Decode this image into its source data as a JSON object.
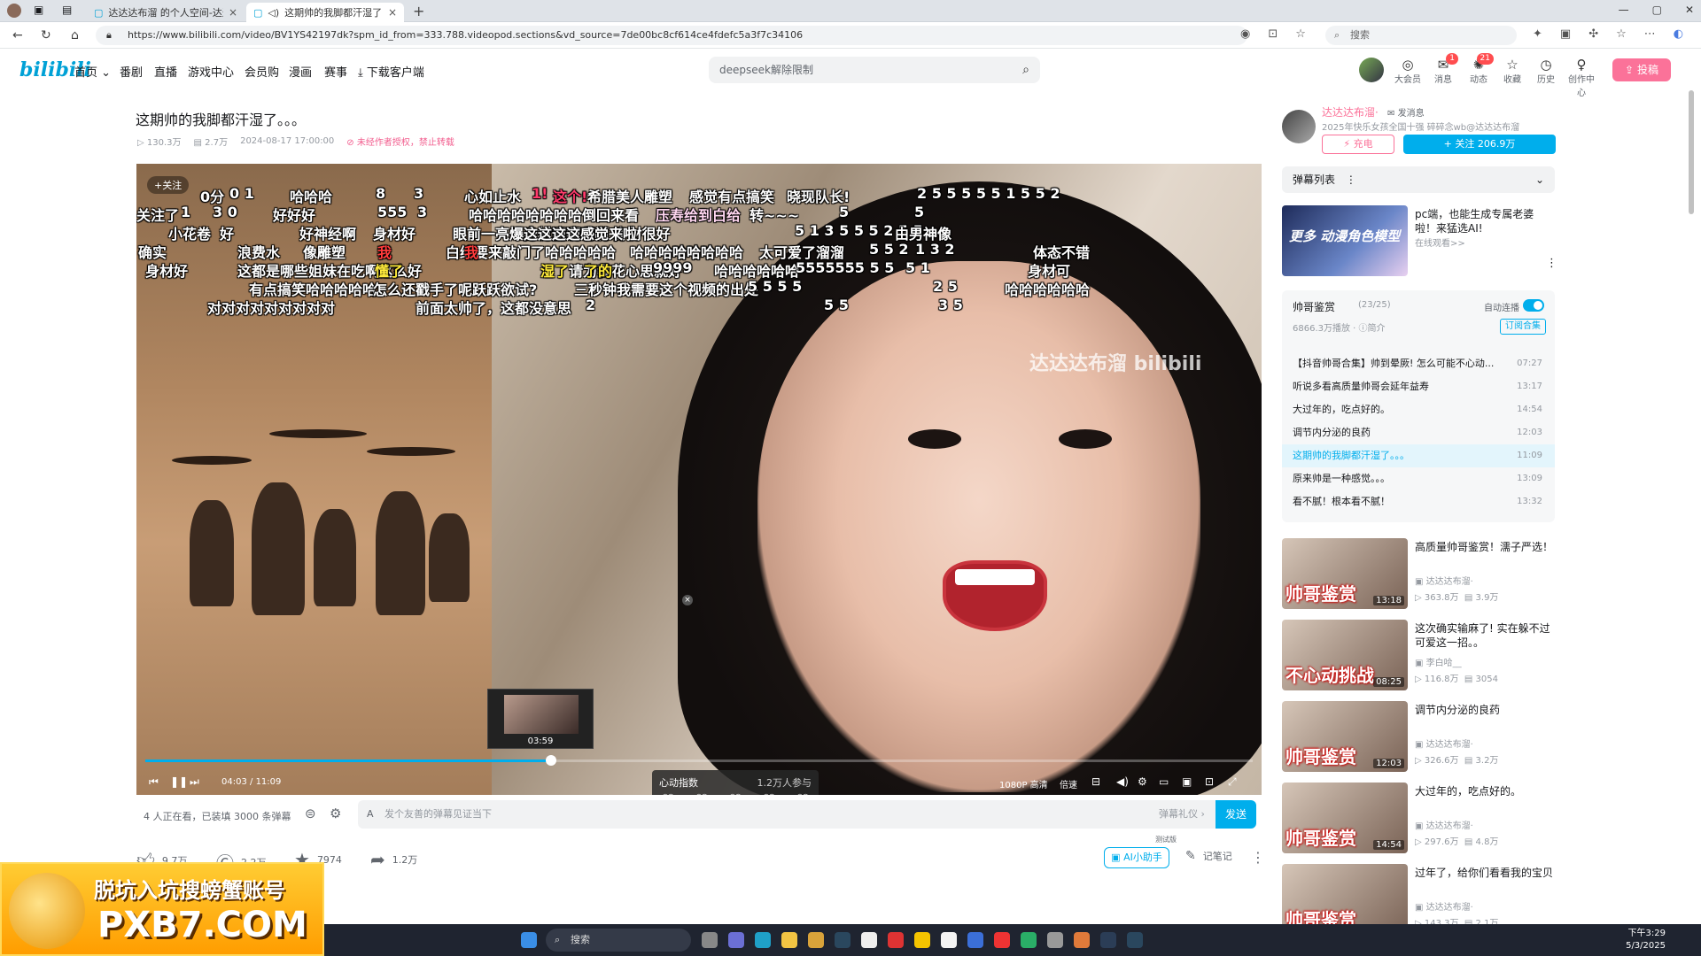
{
  "browser": {
    "tabs": [
      {
        "label": "达达达布溜 的个人空间-达达达布..."
      },
      {
        "label": "这期帅的我脚都汗湿了。。。"
      }
    ],
    "url": "https://www.bilibili.com/video/BV1YS42197dk?spm_id_from=333.788.videopod.sections&vd_source=7de00bc8cf614ce4fdefc5a3f7c34106",
    "search_placeholder": "搜索"
  },
  "site_header": {
    "logo": "bilibili",
    "nav": [
      "首页",
      "番剧",
      "直播",
      "游戏中心",
      "会员购",
      "漫画",
      "赛事",
      "下载客户端"
    ],
    "search_placeholder": "deepseek解除限制",
    "icons": [
      {
        "label": "大会员",
        "icon": "vip-icon"
      },
      {
        "label": "消息",
        "icon": "message-icon",
        "badge": "1"
      },
      {
        "label": "动态",
        "icon": "dynamic-icon",
        "badge": "21"
      },
      {
        "label": "收藏",
        "icon": "favorite-icon"
      },
      {
        "label": "历史",
        "icon": "history-icon"
      },
      {
        "label": "创作中心",
        "icon": "creator-icon"
      }
    ],
    "upload_label": "投稿"
  },
  "video": {
    "title": "这期帅的我脚都汗湿了。。。",
    "views": "130.3万",
    "danmaku_count": "2.7万",
    "date": "2024-08-17 17:00:00",
    "copyright": "未经作者授权，禁止转载"
  },
  "player": {
    "watermark": "达达达布溜 bilibili",
    "danmaku": [
      {
        "text": "0分",
        "c": "#fff"
      },
      {
        "text": "0 1",
        "c": "#fff"
      },
      {
        "text": "哈哈哈",
        "c": "#fff"
      },
      {
        "text": "8",
        "c": "#fff"
      },
      {
        "text": "3",
        "c": "#fff"
      },
      {
        "text": "心如止水",
        "c": "#fff"
      },
      {
        "text": "1!",
        "c": "#ff3b6b"
      },
      {
        "text": "这个!",
        "c": "#ff3b6b"
      },
      {
        "text": "希腊美人雕塑",
        "c": "#fff"
      },
      {
        "text": "感觉有点搞笑",
        "c": "#fff"
      },
      {
        "text": "晓现队长!",
        "c": "#fff"
      },
      {
        "text": "2 5 5 5 5 5 1 5 5 2",
        "c": "#fff"
      },
      {
        "text": "关注了",
        "c": "#fff"
      },
      {
        "text": "1",
        "c": "#fff"
      },
      {
        "text": "3 0",
        "c": "#fff"
      },
      {
        "text": "好好好",
        "c": "#fff"
      },
      {
        "text": "555",
        "c": "#fff"
      },
      {
        "text": "3",
        "c": "#fff"
      },
      {
        "text": "哈哈哈哈哈哈哈哈倒回来看",
        "c": "#fff"
      },
      {
        "text": "压寿给到白给",
        "c": "#ffd6f0"
      },
      {
        "text": "转~~~",
        "c": "#fff"
      },
      {
        "text": "5",
        "c": "#fff"
      },
      {
        "text": "5",
        "c": "#fff"
      },
      {
        "text": "小花卷",
        "c": "#fff"
      },
      {
        "text": "好",
        "c": "#fff"
      },
      {
        "text": "好神经啊",
        "c": "#fff"
      },
      {
        "text": "身材好",
        "c": "#fff"
      },
      {
        "text": "眼前一亮爆身材丽啊啊啊 身材很好",
        "c": "#fff"
      },
      {
        "text": "这这这这感觉来啦",
        "c": "#fff"
      },
      {
        "text": "5 1 3 5 5 5 2 5 5",
        "c": "#fff"
      },
      {
        "text": "由男神像",
        "c": "#fff"
      },
      {
        "text": "确实",
        "c": "#fff"
      },
      {
        "text": "浪费水",
        "c": "#fff"
      },
      {
        "text": "像雕塑",
        "c": "#fff"
      },
      {
        "text": "我",
        "c": "#ff3b3b"
      },
      {
        "text": "白给要来敲门了哈哈哈哈哈",
        "c": "#fff"
      },
      {
        "text": "我",
        "c": "#ff3b3b"
      },
      {
        "text": "哈哈哈哈哈哈",
        "c": "#fff"
      },
      {
        "text": "哈哈哈哈哈哈",
        "c": "#fff"
      },
      {
        "text": "太可爱了溜溜",
        "c": "#fff"
      },
      {
        "text": "5 5 2",
        "c": "#fff"
      },
      {
        "text": "1 3 2",
        "c": "#fff"
      },
      {
        "text": "体态不错",
        "c": "#fff"
      },
      {
        "text": "身材好",
        "c": "#fff"
      },
      {
        "text": "这都是哪些姐妹在吃啊这么好",
        "c": "#fff"
      },
      {
        "text": "懂了",
        "c": "#ffeb3b"
      },
      {
        "text": "湿了",
        "c": "#ffeb3b"
      },
      {
        "text": "请为我花心思就好",
        "c": "#fff"
      },
      {
        "text": "了的",
        "c": "#ffeb3b"
      },
      {
        "text": "9999",
        "c": "#fff"
      },
      {
        "text": "哈哈哈哈哈哈",
        "c": "#fff"
      },
      {
        "text": "5555555 5 5",
        "c": "#fff"
      },
      {
        "text": "5 1",
        "c": "#fff"
      },
      {
        "text": "身材可",
        "c": "#fff"
      },
      {
        "text": "有点搞笑哈哈哈哈哈",
        "c": "#fff"
      },
      {
        "text": "怎么还戳手了呢跃跃欲试?",
        "c": "#fff"
      },
      {
        "text": "三秒钟我需要这个视频的出处",
        "c": "#fff"
      },
      {
        "text": "5 5 5 5",
        "c": "#fff"
      },
      {
        "text": "2 5",
        "c": "#fff"
      },
      {
        "text": "哈哈哈哈哈哈",
        "c": "#fff"
      },
      {
        "text": "对对对对对对对对对",
        "c": "#fff"
      },
      {
        "text": "前面太帅了，这都没意思",
        "c": "#fff"
      },
      {
        "text": "2",
        "c": "#fff"
      },
      {
        "text": "5 5",
        "c": "#fff"
      },
      {
        "text": "3 5",
        "c": "#fff"
      }
    ],
    "follow_chip": "+关注",
    "vote": {
      "title": "心动指数",
      "count": "1.2万人参与",
      "close": "×"
    },
    "preview_time": "03:59",
    "progress": 0.366,
    "time_current": "04:03",
    "time_total": "11:09",
    "quality": "1080P 高清",
    "speed": "倍速"
  },
  "sendbar": {
    "viewers": "4 人正在看，已装填 3000 条弹幕",
    "placeholder": "发个友善的弹幕见证当下",
    "gift": "弹幕礼仪 ›",
    "send": "发送"
  },
  "actions": {
    "like": "9.7万",
    "coin": "2.2万",
    "fav": "7974",
    "share": "1.2万",
    "ai": "AI小助手",
    "beta": "测试版",
    "notes": "记笔记"
  },
  "uploader": {
    "name": "达达达布溜·",
    "msg": "发消息",
    "desc": "2025年快乐女孩全国十强 碎碎念wb@达达达布溜",
    "charge": "充电",
    "follow": "+ 关注 206.9万"
  },
  "dm_list": {
    "label": "弹幕列表",
    "more": "⋮"
  },
  "ad_card": {
    "title": "pc端，也能生成专属老婆啦！来猛选AI!",
    "sub": "在线观看>>",
    "img_text": "更多 动漫角色模型"
  },
  "playlist": {
    "title": "帅哥鉴赏",
    "count": "(23/25)",
    "auto": "自动连播",
    "views": "6866.3万播放",
    "intro": "简介",
    "subscribe": "订阅合集",
    "items": [
      {
        "title": "【抖音帅哥合集】帅到晕厥! 怎么可能不心动...",
        "dur": "07:27",
        "current": false
      },
      {
        "title": "听说多看高质量帅哥会延年益寿",
        "dur": "13:17",
        "current": false
      },
      {
        "title": "大过年的，吃点好的。",
        "dur": "14:54",
        "current": false
      },
      {
        "title": "调节内分泌的良药",
        "dur": "12:03",
        "current": false
      },
      {
        "title": "这期帅的我脚都汗湿了。。。",
        "dur": "11:09",
        "current": true
      },
      {
        "title": "原来帅是一种感觉。。。",
        "dur": "13:09",
        "current": false
      },
      {
        "title": "看不腻！根本看不腻！",
        "dur": "13:32",
        "current": false
      }
    ]
  },
  "recommendations": [
    {
      "title": "高质量帅哥鉴赏！濡子严选！",
      "author": "达达达布溜·",
      "views": "363.8万",
      "dm": "3.9万",
      "dur": "13:18",
      "cap": "帅哥鉴赏"
    },
    {
      "title": "这次确实输麻了! 实在躲不过可爱这一招。。",
      "author": "李白哈__",
      "views": "116.8万",
      "dm": "3054",
      "dur": "08:25",
      "cap": "不心动挑战"
    },
    {
      "title": "调节内分泌的良药",
      "author": "达达达布溜·",
      "views": "326.6万",
      "dm": "3.2万",
      "dur": "12:03",
      "cap": "帅哥鉴赏"
    },
    {
      "title": "大过年的，吃点好的。",
      "author": "达达达布溜·",
      "views": "297.6万",
      "dm": "4.8万",
      "dur": "14:54",
      "cap": "帅哥鉴赏"
    },
    {
      "title": "过年了，给你们看看我的宝贝",
      "author": "达达达布溜·",
      "views": "143.3万",
      "dm": "2.1万",
      "dur": "",
      "cap": "帅哥鉴赏"
    }
  ],
  "ad_overlay": {
    "line1": "脱坑入坑搜螃蟹账号",
    "line2": "PXB7.COM"
  },
  "taskbar": {
    "search": "搜索",
    "time": "下午3:29",
    "date": "5/3/2025"
  }
}
